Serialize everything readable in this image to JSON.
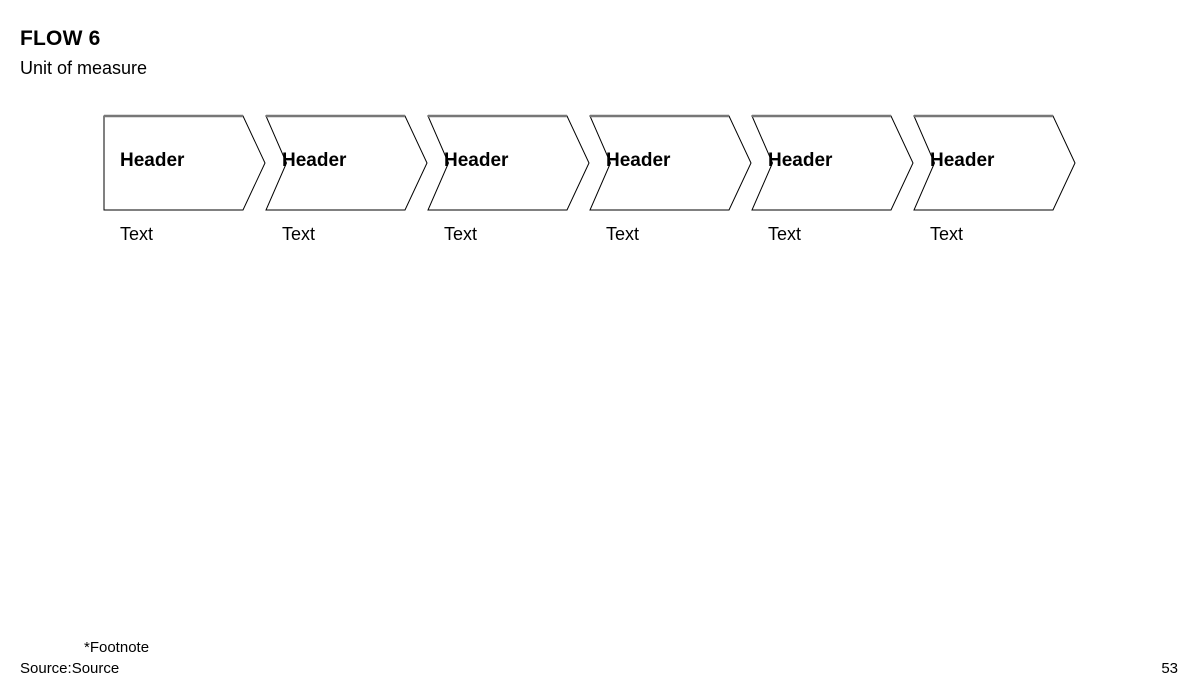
{
  "slide": {
    "title": "FLOW 6",
    "subtitle": "Unit of measure",
    "page_number": "53"
  },
  "flow": {
    "steps": [
      {
        "header": "Header",
        "caption": "Text"
      },
      {
        "header": "Header",
        "caption": "Text"
      },
      {
        "header": "Header",
        "caption": "Text"
      },
      {
        "header": "Header",
        "caption": "Text"
      },
      {
        "header": "Header",
        "caption": "Text"
      },
      {
        "header": "Header",
        "caption": "Text"
      }
    ]
  },
  "footer": {
    "footnote": "*Footnote",
    "source": "Source:Source"
  },
  "colors": {
    "text": "#000000",
    "background": "#ffffff",
    "shape_stroke": "#000000",
    "shape_fill": "#ffffff",
    "top_edge": "#777777"
  }
}
